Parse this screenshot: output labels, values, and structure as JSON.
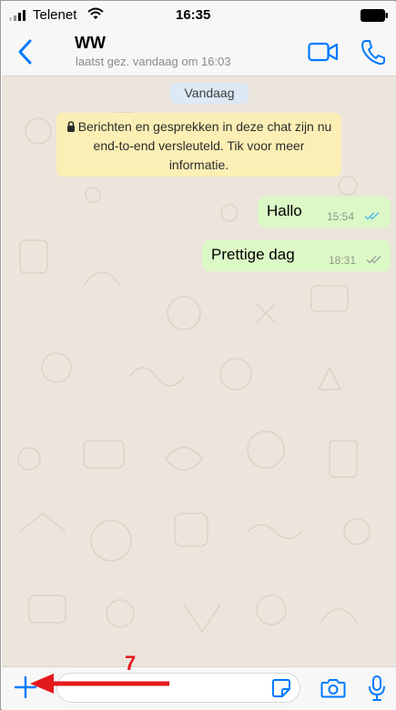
{
  "status_bar": {
    "carrier": "Telenet",
    "time": "16:35",
    "icons": [
      "signal-icon",
      "wifi-icon",
      "battery-icon"
    ]
  },
  "header": {
    "contact_name": "WW",
    "last_seen": "laatst gez. vandaag om 16:03",
    "icons": [
      "back-icon",
      "video-call-icon",
      "phone-icon"
    ]
  },
  "chat": {
    "date_label": "Vandaag",
    "encryption_notice": "Berichten en gesprekken in deze chat zijn nu end-to-end versleuteld. Tik voor meer informatie.",
    "messages": [
      {
        "text": "Hallo",
        "time": "15:54",
        "status": "read"
      },
      {
        "text": "Prettige dag",
        "time": "18:31",
        "status": "delivered"
      }
    ]
  },
  "input_bar": {
    "placeholder": "",
    "icons": [
      "plus-icon",
      "sticker-icon",
      "camera-icon",
      "microphone-icon"
    ]
  },
  "annotation": {
    "number": "7"
  },
  "colors": {
    "accent": "#007aff",
    "outgoing_bubble": "#dcf8c6",
    "notice_bg": "#fbefb5",
    "date_chip_bg": "#dde9f4",
    "chat_bg": "#ece5dc",
    "read_ticks": "#53bdeb",
    "annotation_red": "#e3191c"
  }
}
